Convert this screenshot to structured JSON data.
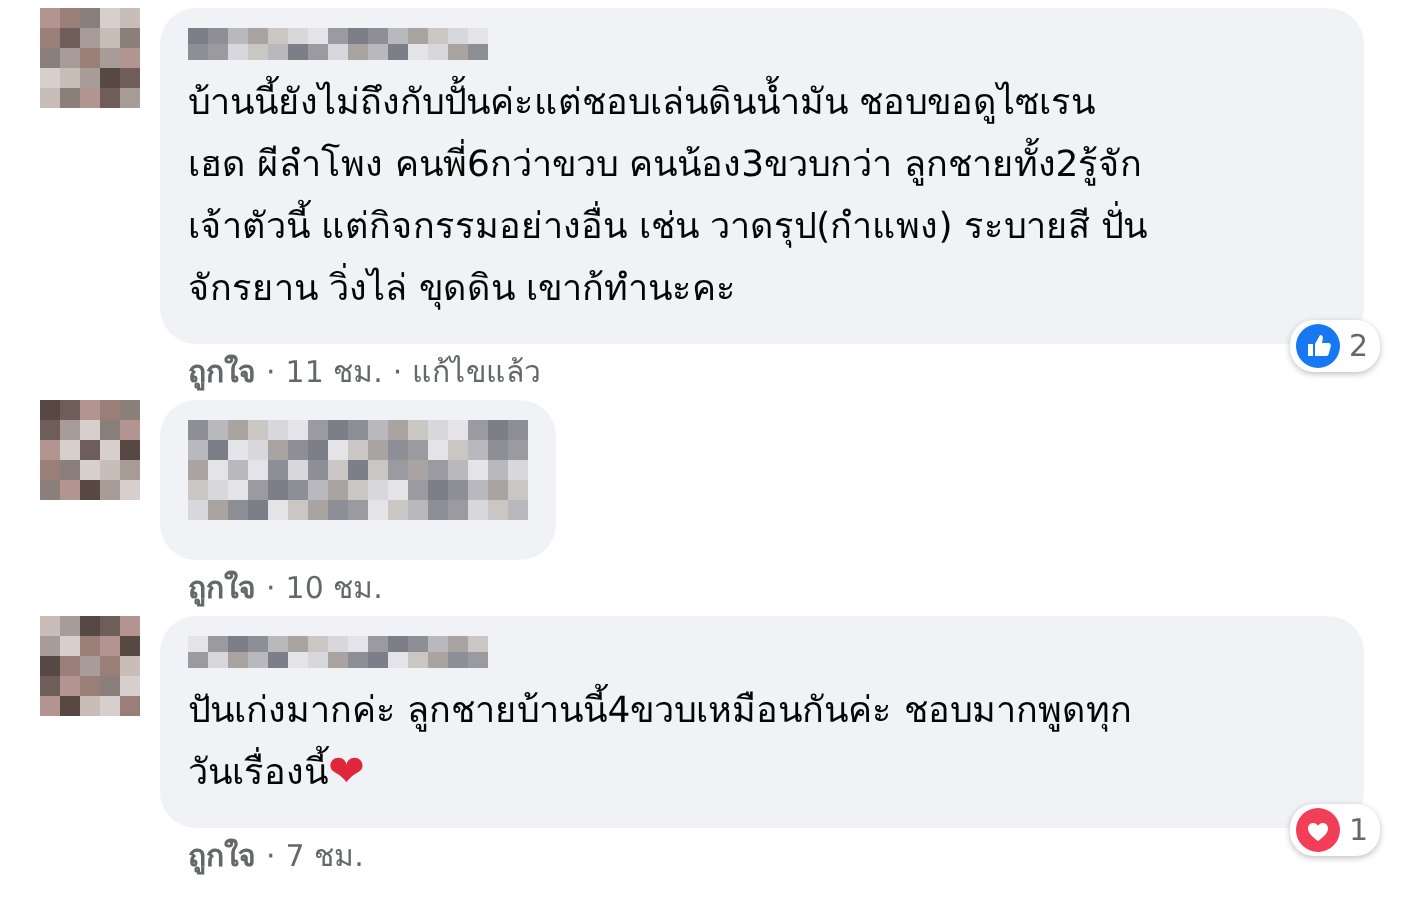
{
  "comments": [
    {
      "kind": "text",
      "lines": [
        "บ้านนี้ยังไม่ถึงกับปั้นค่ะแต่ชอบเล่นดินน้ำมัน ชอบขอดูไซเรน",
        "เฮด ผีลำโพง คนพี่6กว่าขวบ คนน้อง3ขวบกว่า ลูกชายทั้ง2รู้จัก",
        "เจ้าตัวนี้ แต่กิจกรรมอย่างอื่น เช่น วาดรุป(กำแพง) ระบายสี ปั่น",
        "จักรยาน วิ่งไล่ ขุดดิน เขาก้ทำนะคะ"
      ],
      "like": "ถูกใจ",
      "separator": "·",
      "time": "11 ชม.",
      "edited": "แก้ไขแล้ว",
      "reaction": {
        "kind": "like",
        "count": "2"
      }
    },
    {
      "kind": "hidden",
      "like": "ถูกใจ",
      "separator": "·",
      "time": "10 ชม."
    },
    {
      "kind": "text",
      "lines": [
        "ปันเก่งมากค่ะ ลูกชายบ้านนี้4ขวบเหมือนกันค่ะ ชอบมากพูดทุก",
        "วันเรื่องนี้"
      ],
      "emoji": "❤",
      "like": "ถูกใจ",
      "separator": "·",
      "time": "7 ชม.",
      "reaction": {
        "kind": "love",
        "count": "1"
      }
    }
  ]
}
